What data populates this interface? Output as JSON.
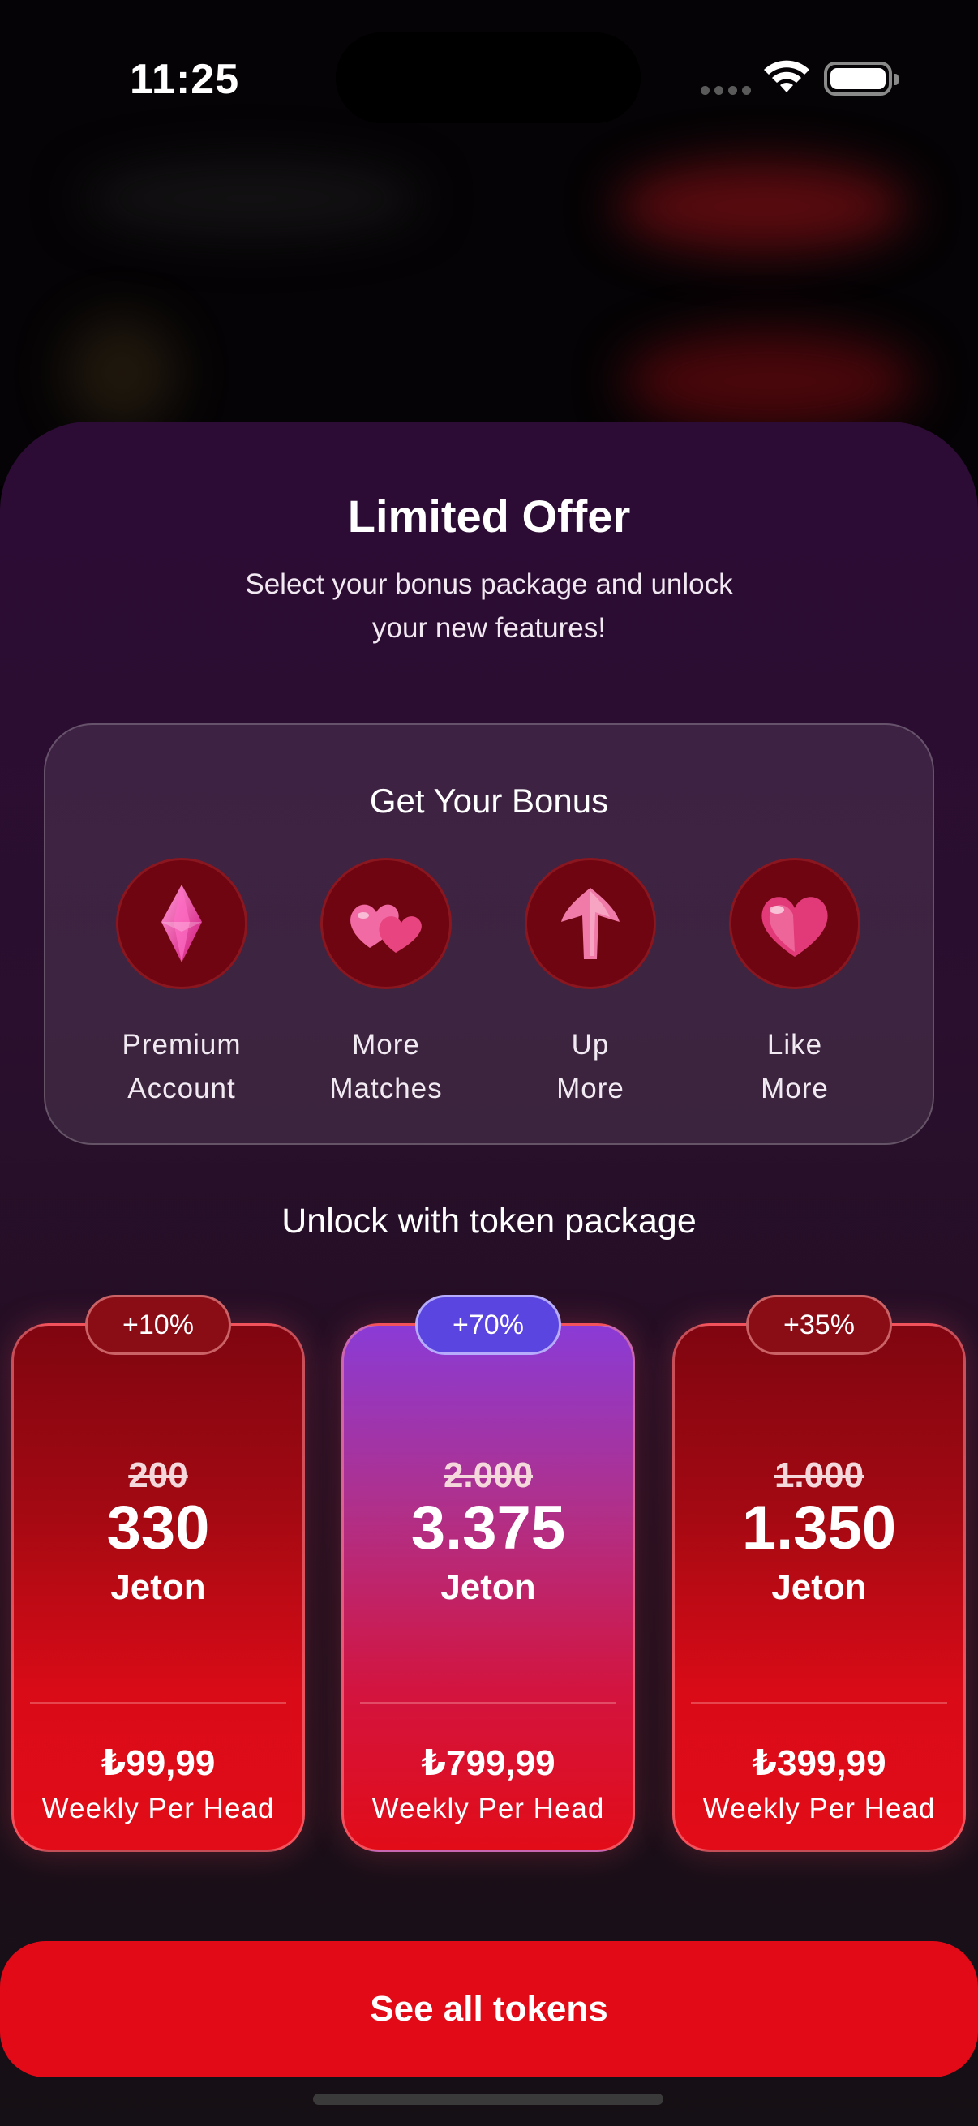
{
  "status_bar": {
    "time": "11:25"
  },
  "header": {
    "title": "Limited Offer",
    "subtitle": "Select your bonus package and unlock your new features!"
  },
  "bonus": {
    "title": "Get Your Bonus",
    "items": [
      {
        "line1": "Premium",
        "line2": "Account",
        "icon": "diamond-icon"
      },
      {
        "line1": "More",
        "line2": "Matches",
        "icon": "hearts-icon"
      },
      {
        "line1": "Up",
        "line2": "More",
        "icon": "up-arrow-icon"
      },
      {
        "line1": "Like",
        "line2": "More",
        "icon": "heart-icon"
      }
    ]
  },
  "packages": {
    "title": "Unlock with token package",
    "cards": [
      {
        "badge": "+10%",
        "old": "200",
        "amount": "330",
        "unit": "Jeton",
        "price": "₺99,99",
        "period": "Weekly Per Head"
      },
      {
        "badge": "+70%",
        "old": "2.000",
        "amount": "3.375",
        "unit": "Jeton",
        "price": "₺799,99",
        "period": "Weekly Per Head"
      },
      {
        "badge": "+35%",
        "old": "1.000",
        "amount": "1.350",
        "unit": "Jeton",
        "price": "₺399,99",
        "period": "Weekly Per Head"
      }
    ]
  },
  "cta": {
    "label": "See all tokens"
  },
  "colors": {
    "accent": "#e30a17",
    "highlight": "#5a45e0",
    "sheet": "#2c0b35"
  }
}
